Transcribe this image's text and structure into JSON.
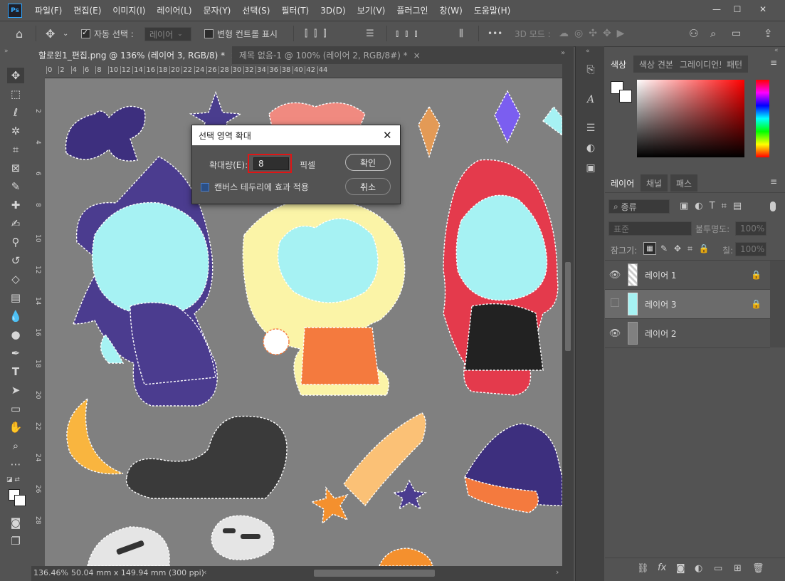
{
  "app": {
    "logo": "Ps"
  },
  "menu": [
    "파일(F)",
    "편집(E)",
    "이미지(I)",
    "레이어(L)",
    "문자(Y)",
    "선택(S)",
    "필터(T)",
    "3D(D)",
    "보기(V)",
    "플러그인",
    "창(W)",
    "도움말(H)"
  ],
  "options": {
    "auto_select_label": "자동 선택 :",
    "auto_select_value": "레이어",
    "transform_label": "변형 컨트롤 표시",
    "mode_label": "3D 모드 :",
    "more": "•••"
  },
  "tabs": [
    {
      "label": "할로윈1_편집.png @ 136% (레이어 3, RGB/8) *",
      "close": "×"
    },
    {
      "label": "제목 없음-1 @ 100% (레이어 2, RGB/8#) *",
      "close": "×"
    }
  ],
  "ruler": {
    "h_ticks": [
      "0",
      "2",
      "4",
      "6",
      "8",
      "10",
      "12",
      "14",
      "16",
      "18",
      "20",
      "22",
      "24",
      "26",
      "28",
      "30",
      "32",
      "34",
      "36",
      "38",
      "40",
      "42",
      "44"
    ],
    "v_ticks": [
      "2",
      "4",
      "6",
      "8",
      "10",
      "12",
      "14",
      "16",
      "18",
      "20",
      "22",
      "24",
      "26",
      "28"
    ]
  },
  "status": {
    "zoom": "136.46%",
    "doc_info": "50.04 mm x 149.94 mm (300 ppi)"
  },
  "dialog": {
    "title": "선택 영역 확대",
    "amount_label": "확대량(E):",
    "amount_value": "8",
    "unit": "픽셀",
    "ok": "확인",
    "cancel": "취소",
    "checkbox_label": "캔버스 테두리에 효과 적용"
  },
  "color_panel": {
    "tabs": [
      "색상",
      "색상 견본",
      "그레이디언트",
      "패턴"
    ]
  },
  "layers_panel": {
    "tabs": [
      "레이어",
      "채널",
      "패스"
    ],
    "filter_kind": "종류",
    "blend_mode": "표준",
    "opacity_label": "불투명도:",
    "opacity_value": "100%",
    "lock_label": "잠그기:",
    "fill_label": "칠:",
    "fill_value": "100%",
    "layers": [
      {
        "name": "레이어 1",
        "visible": true
      },
      {
        "name": "레이어 3",
        "visible": false
      },
      {
        "name": "레이어 2",
        "visible": true
      }
    ],
    "footer_fx": "fx"
  },
  "colors": {
    "accent_highlight": "#e01515",
    "canvas_gray": "#808080",
    "panel_bg": "#535353"
  }
}
